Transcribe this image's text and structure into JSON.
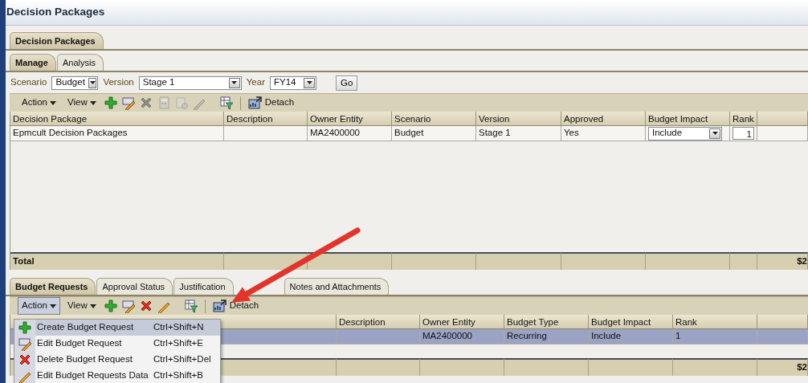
{
  "window": {
    "title": "Decision Packages"
  },
  "outer_tabs": [
    {
      "label": "Decision Packages",
      "selected": true
    }
  ],
  "tabs": [
    {
      "label": "Manage",
      "selected": true
    },
    {
      "label": "Analysis",
      "selected": false
    }
  ],
  "filters": [
    {
      "label": "Scenario",
      "value": "Budget"
    },
    {
      "label": "Version",
      "value": "Stage 1"
    },
    {
      "label": "Year",
      "value": "FY14"
    }
  ],
  "go_button": "Go",
  "toolbar": {
    "menus": [
      {
        "label": "Action",
        "open": false
      },
      {
        "label": "View",
        "open": false
      }
    ],
    "icons": [
      {
        "kind": "add",
        "disabled": false
      },
      {
        "kind": "edit",
        "disabled": false
      },
      {
        "kind": "delete",
        "disabled": true
      },
      {
        "kind": "calc",
        "disabled": true
      },
      {
        "kind": "copy",
        "disabled": true
      },
      {
        "kind": "pencil",
        "disabled": true
      },
      {
        "kind": "filter",
        "disabled": false
      }
    ],
    "detach": "Detach"
  },
  "packages": {
    "columns": [
      "Decision Package",
      "Description",
      "Owner Entity",
      "Scenario",
      "Version",
      "Approved",
      "Budget Impact",
      "Rank",
      null
    ],
    "rows": [
      {
        "selected": false,
        "cells": [
          {
            "kind": "text",
            "value": "Epmcult Decision Packages"
          },
          {
            "kind": "text"
          },
          {
            "kind": "text",
            "value": "MA2400000"
          },
          {
            "kind": "text",
            "value": "Budget"
          },
          {
            "kind": "text",
            "value": "Stage 1"
          },
          {
            "kind": "text",
            "value": "Yes"
          },
          {
            "kind": "select",
            "value": "Include"
          },
          {
            "kind": "number",
            "value": "1"
          },
          {
            "kind": "text"
          }
        ]
      }
    ],
    "total": {
      "label": "Total",
      "amount": "$2"
    }
  },
  "request_tabs": [
    {
      "label": "Budget Requests",
      "selected": true
    },
    {
      "label": "Approval Status",
      "selected": false
    },
    {
      "label": "Justification",
      "selected": false
    },
    {
      "label": "Notes and Attachments",
      "selected": false
    }
  ],
  "request_toolbar": {
    "menus": [
      {
        "label": "Action",
        "open": true
      },
      {
        "label": "View",
        "open": false
      }
    ],
    "icons": [
      {
        "kind": "add",
        "disabled": false
      },
      {
        "kind": "edit",
        "disabled": false
      },
      {
        "kind": "delete",
        "disabled": false
      },
      {
        "kind": "pencil",
        "disabled": false
      },
      {
        "kind": "filter",
        "disabled": false
      }
    ],
    "detach": "Detach"
  },
  "requests": {
    "columns": [
      null,
      "Description",
      "Owner Entity",
      "Budget Type",
      "Budget Impact",
      "Rank",
      null
    ],
    "rows": [
      {
        "selected": true,
        "cells": [
          {
            "kind": "text"
          },
          {
            "kind": "text"
          },
          {
            "kind": "text",
            "value": "MA2400000"
          },
          {
            "kind": "text",
            "value": "Recurring"
          },
          {
            "kind": "text",
            "value": "Include"
          },
          {
            "kind": "text",
            "value": "1"
          },
          {
            "kind": "text"
          }
        ]
      }
    ],
    "total": {
      "amount": "$2"
    }
  },
  "action_menu": [
    {
      "kind": "add",
      "label": "Create Budget Request",
      "shortcut": "Ctrl+Shift+N",
      "selected": true
    },
    {
      "kind": "edit",
      "label": "Edit Budget Request",
      "shortcut": "Ctrl+Shift+E",
      "selected": false
    },
    {
      "kind": "delete",
      "label": "Delete Budget Request",
      "shortcut": "Ctrl+Shift+Del",
      "selected": false
    },
    {
      "kind": "pencil",
      "label": "Edit Budget Requests Data",
      "shortcut": "Ctrl+Shift+B",
      "selected": false
    }
  ],
  "annotation": {
    "kind": "arrow"
  }
}
